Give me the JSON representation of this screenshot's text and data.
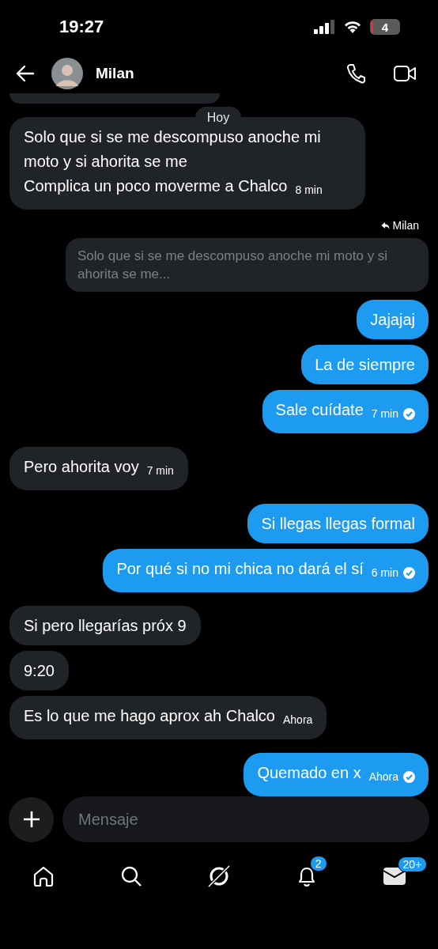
{
  "status_bar": {
    "time": "19:27",
    "battery": "4"
  },
  "header": {
    "name": "Milan"
  },
  "date_label": "Hoy",
  "messages": [
    {
      "kind": "incoming",
      "text": "Solo que si se me descompuso anoche mi moto y si ahorita se me\nComplica un poco moverme a Chalco",
      "time": "8 min"
    },
    {
      "kind": "outgoing",
      "reply_to": "Milan",
      "quote": "Solo que si se me descompuso anoche mi moto y si ahorita se me...",
      "text": "Jajajaj"
    },
    {
      "kind": "outgoing",
      "text": "La de siempre"
    },
    {
      "kind": "outgoing",
      "text": "Sale cuídate",
      "time": "7 min",
      "read": true
    },
    {
      "kind": "incoming",
      "text": "Pero ahorita voy",
      "time": "7 min"
    },
    {
      "kind": "outgoing",
      "text": "Si llegas llegas formal"
    },
    {
      "kind": "outgoing",
      "text": "Por qué si no mi chica no dará el sí",
      "time": "6 min",
      "read": true
    },
    {
      "kind": "incoming",
      "text": "Si pero llegarías próx 9"
    },
    {
      "kind": "incoming",
      "text": "9:20"
    },
    {
      "kind": "incoming",
      "text": "Es lo que me hago aprox ah Chalco",
      "time": "Ahora"
    },
    {
      "kind": "outgoing",
      "text": "Quemado en x",
      "time": "Ahora",
      "read": true
    }
  ],
  "composer": {
    "placeholder": "Mensaje"
  },
  "nav": [
    {
      "kind": "home"
    },
    {
      "kind": "search"
    },
    {
      "kind": "grok"
    },
    {
      "kind": "bell",
      "badge": "2"
    },
    {
      "kind": "mail",
      "badge": "20+"
    }
  ]
}
